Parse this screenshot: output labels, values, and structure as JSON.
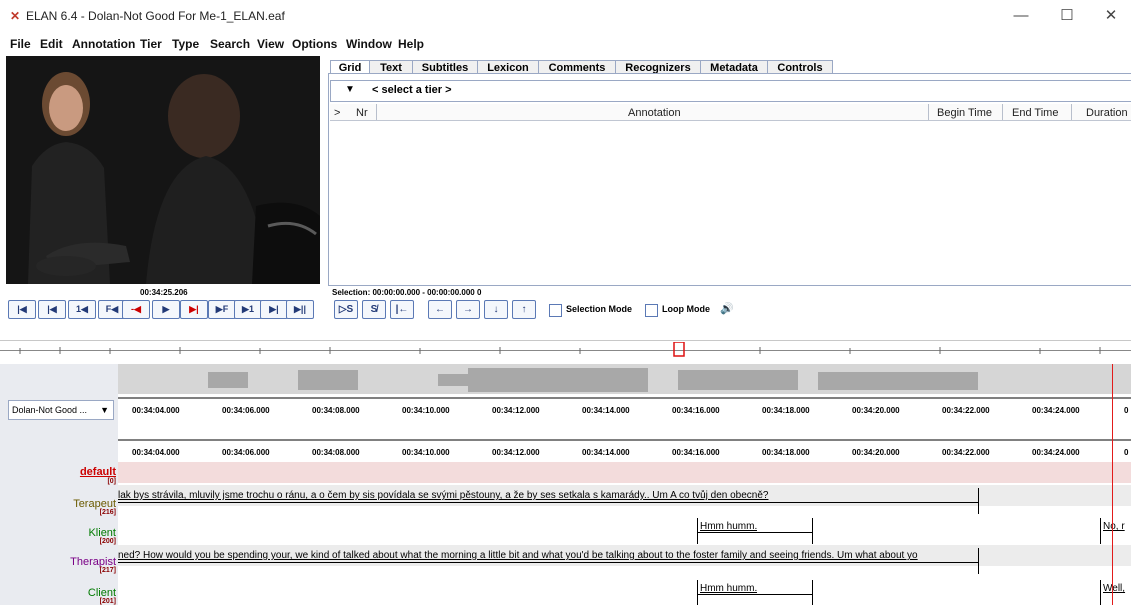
{
  "window": {
    "title": "ELAN 6.4 - Dolan-Not Good For Me-1_ELAN.eaf",
    "minimize": "—",
    "maximize": "☐",
    "close": "✕"
  },
  "menu": [
    "File",
    "Edit",
    "Annotation",
    "Tier",
    "Type",
    "Search",
    "View",
    "Options",
    "Window",
    "Help"
  ],
  "player": {
    "time": "00:34:25.206",
    "buttons": [
      "|◀",
      "|◀",
      "1◀",
      "F◀",
      "-◀",
      "▶",
      "▶|",
      "▶F",
      "▶1",
      "▶|",
      "▶||"
    ]
  },
  "tabs": [
    "Grid",
    "Text",
    "Subtitles",
    "Lexicon",
    "Comments",
    "Recognizers",
    "Metadata",
    "Controls"
  ],
  "grid": {
    "tier_placeholder": "< select a tier >",
    "columns": {
      "marker": ">",
      "nr": "Nr",
      "annotation": "Annotation",
      "begin": "Begin Time",
      "end": "End Time",
      "duration": "Duration"
    }
  },
  "selection": {
    "label": "Selection: 00:00:00.000 - 00:00:00.000  0",
    "buttons": [
      "▷S",
      "S̸",
      "|←",
      "←",
      "→",
      "↓",
      "↑"
    ],
    "selection_mode": "Selection Mode",
    "loop_mode": "Loop Mode",
    "volume_icon": "🔊"
  },
  "media_combo": "Dolan-Not Good ...",
  "ruler_ticks": [
    "00:34:04.000",
    "00:34:06.000",
    "00:34:08.000",
    "00:34:10.000",
    "00:34:12.000",
    "00:34:14.000",
    "00:34:16.000",
    "00:34:18.000",
    "00:34:20.000",
    "00:34:22.000",
    "00:34:24.000",
    "0"
  ],
  "tiers": [
    {
      "name": "default",
      "count": "[0]",
      "color": "#cc0000"
    },
    {
      "name": "Terapeut",
      "count": "[216]",
      "color": "#6b5b00"
    },
    {
      "name": "Klient",
      "count": "[200]",
      "color": "#007a00"
    },
    {
      "name": "Therapist",
      "count": "[217]",
      "color": "#7a0086"
    },
    {
      "name": "Client",
      "count": "[201]",
      "color": "#007a00"
    }
  ],
  "annotations": {
    "terapeut": "lak bys strávila, mluvily jsme trochu o ránu, a o čem by sis povídala se svými pěstouny, a že by ses setkala s kamarády.. Um A co tvůj den obecně?",
    "klient_1": "Hmm humm.",
    "klient_2": "No, r",
    "therapist": "ned? How would you be spending your, we kind of talked about what the morning a little bit and what you'd be talking about to the foster family and seeing friends. Um what about yo",
    "client_1": "Hmm humm.",
    "client_2": "Well,"
  }
}
